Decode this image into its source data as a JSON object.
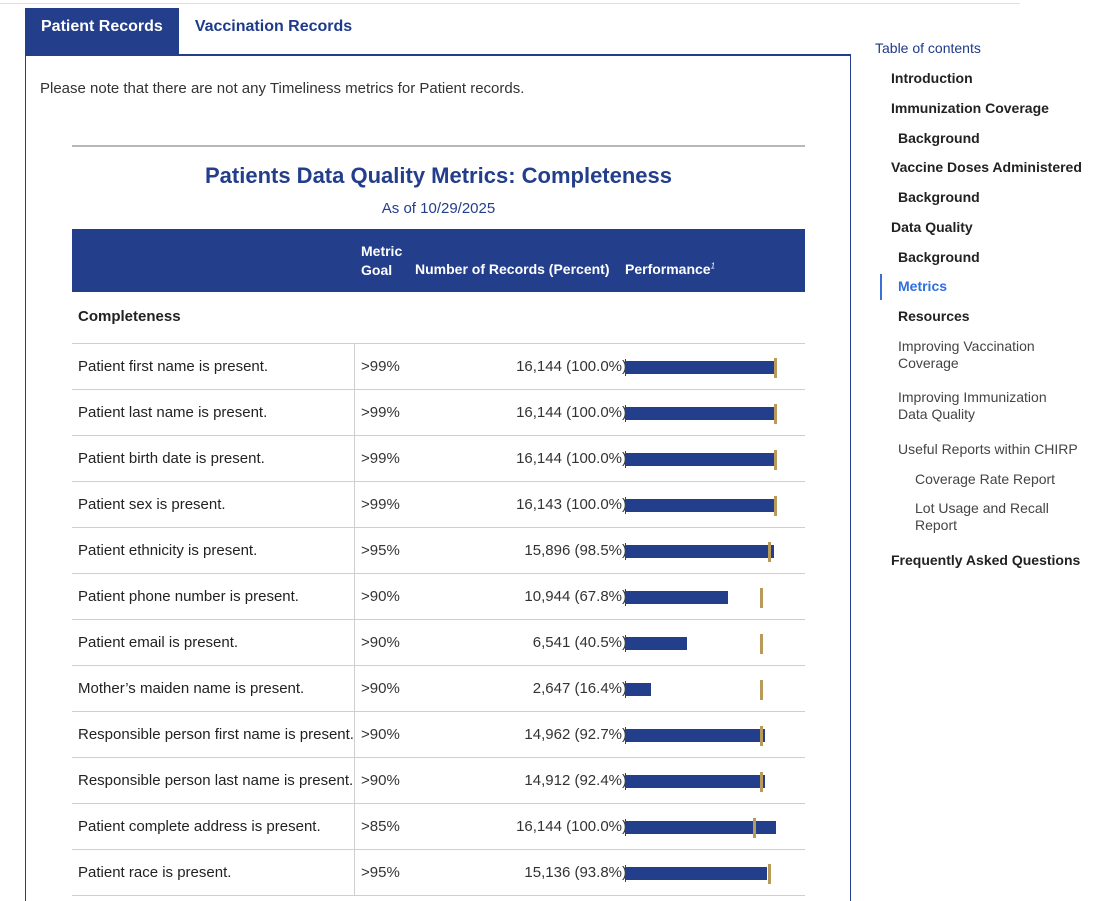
{
  "tabs": [
    {
      "label": "Patient Records",
      "active": true
    },
    {
      "label": "Vaccination Records",
      "active": false
    }
  ],
  "note": "Please note that there are not any Timeliness metrics for Patient records.",
  "table": {
    "title": "Patients Data Quality Metrics: Completeness",
    "subtitle": "As of 10/29/2025",
    "headers": {
      "metric_goal_line1": "Metric",
      "metric_goal_line2": "Goal",
      "num_records": "Number of Records (Percent)",
      "performance": "Performance",
      "performance_footnote": "1"
    },
    "section_label": "Completeness",
    "rows": [
      {
        "label": "Patient first name is present.",
        "goal": ">99%",
        "records": "16,144 (100.0%)",
        "percent": 100.0,
        "goal_pct": 99
      },
      {
        "label": "Patient last name is present.",
        "goal": ">99%",
        "records": "16,144 (100.0%)",
        "percent": 100.0,
        "goal_pct": 99
      },
      {
        "label": "Patient birth date is present.",
        "goal": ">99%",
        "records": "16,144 (100.0%)",
        "percent": 100.0,
        "goal_pct": 99
      },
      {
        "label": "Patient sex is present.",
        "goal": ">99%",
        "records": "16,143 (100.0%)",
        "percent": 100.0,
        "goal_pct": 99
      },
      {
        "label": "Patient ethnicity is present.",
        "goal": ">95%",
        "records": "15,896 (98.5%)",
        "percent": 98.5,
        "goal_pct": 95
      },
      {
        "label": "Patient phone number is present.",
        "goal": ">90%",
        "records": "10,944 (67.8%)",
        "percent": 67.8,
        "goal_pct": 90
      },
      {
        "label": "Patient email is present.",
        "goal": ">90%",
        "records": "6,541 (40.5%)",
        "percent": 40.5,
        "goal_pct": 90
      },
      {
        "label": "Mother’s maiden name is present.",
        "goal": ">90%",
        "records": "2,647 (16.4%)",
        "percent": 16.4,
        "goal_pct": 90
      },
      {
        "label": "Responsible person first name is present.",
        "goal": ">90%",
        "records": "14,962 (92.7%)",
        "percent": 92.7,
        "goal_pct": 90
      },
      {
        "label": "Responsible person last name is present.",
        "goal": ">90%",
        "records": "14,912 (92.4%)",
        "percent": 92.4,
        "goal_pct": 90
      },
      {
        "label": "Patient complete address is present.",
        "goal": ">85%",
        "records": "16,144 (100.0%)",
        "percent": 100.0,
        "goal_pct": 85
      },
      {
        "label": "Patient race is present.",
        "goal": ">95%",
        "records": "15,136 (93.8%)",
        "percent": 93.8,
        "goal_pct": 95
      }
    ]
  },
  "toc": {
    "title": "Table of contents",
    "items": [
      {
        "label": "Introduction",
        "level": 1,
        "style": "bold"
      },
      {
        "label": "Immunization Coverage",
        "level": 1,
        "style": "bold"
      },
      {
        "label": "Background",
        "level": 2,
        "style": "bold"
      },
      {
        "label": "Vaccine Doses Administered",
        "level": 1,
        "style": "bold"
      },
      {
        "label": "Background",
        "level": 2,
        "style": "bold"
      },
      {
        "label": "Data Quality",
        "level": 1,
        "style": "bold"
      },
      {
        "label": "Background",
        "level": 2,
        "style": "bold"
      },
      {
        "label": "Metrics",
        "level": 2,
        "style": "active"
      },
      {
        "label": "Resources",
        "level": 2,
        "style": "bold"
      },
      {
        "label": "Improving Vaccination Coverage",
        "level": 2,
        "style": "normal"
      },
      {
        "label": "Improving Immunization Data Quality",
        "level": 2,
        "style": "normal"
      },
      {
        "label": "Useful Reports within CHIRP",
        "level": 2,
        "style": "normal"
      },
      {
        "label": "Coverage Rate Report",
        "level": 3,
        "style": "normal"
      },
      {
        "label": "Lot Usage and Recall Report",
        "level": 3,
        "style": "normal"
      },
      {
        "label": "Frequently Asked Questions",
        "level": 1,
        "style": "bold"
      }
    ]
  },
  "colors": {
    "bar": "#233e8b",
    "goal_marker": "#b89a5a",
    "header_bg": "#233e8b",
    "active_link": "#2f6fe0"
  }
}
